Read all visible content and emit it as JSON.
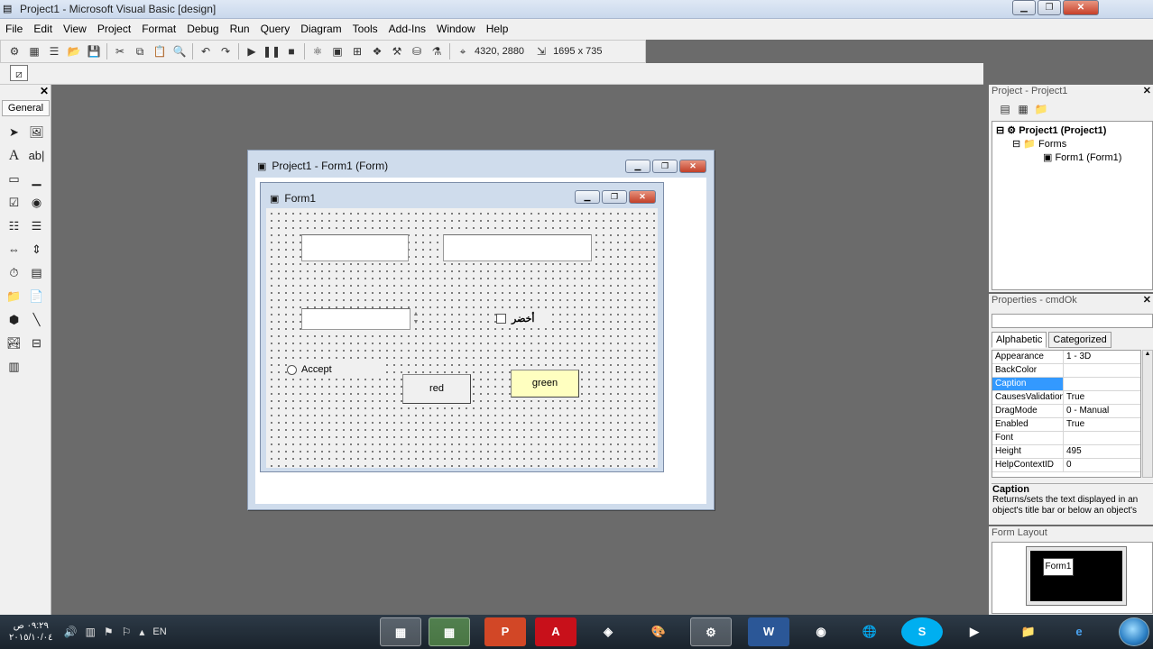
{
  "window": {
    "title": "Project1 - Microsoft Visual Basic [design]",
    "minimize": "▁",
    "restore": "❐",
    "close": "✕"
  },
  "menu": [
    "File",
    "Edit",
    "View",
    "Project",
    "Format",
    "Debug",
    "Run",
    "Query",
    "Diagram",
    "Tools",
    "Add-Ins",
    "Window",
    "Help"
  ],
  "toolbar": {
    "position": "4320, 2880",
    "size": "1695 x 735"
  },
  "toolbox": {
    "tab_label": "General",
    "close": "✕"
  },
  "form_window": {
    "title": "Project1 - Form1 (Form)"
  },
  "form1": {
    "title": "Form1",
    "checkbox_label": "أخضر",
    "radio_label": "Accept",
    "button_red": "red",
    "button_green": "green"
  },
  "project_explorer": {
    "title": "Project - Project1",
    "close": "✕",
    "root": "Project1 (Project1)",
    "folder": "Forms",
    "item": "Form1 (Form1)"
  },
  "properties": {
    "title": "Properties - cmdOk",
    "tabs": [
      "Alphabetic",
      "Categorized"
    ],
    "rows": [
      {
        "name": "Appearance",
        "value": "1 - 3D"
      },
      {
        "name": "BackColor",
        "value": ""
      },
      {
        "name": "Caption",
        "value": ""
      },
      {
        "name": "CausesValidation",
        "value": "True"
      },
      {
        "name": "DragMode",
        "value": "0 - Manual"
      },
      {
        "name": "Enabled",
        "value": "True"
      },
      {
        "name": "Font",
        "value": ""
      },
      {
        "name": "Height",
        "value": "495"
      },
      {
        "name": "HelpContextID",
        "value": "0"
      }
    ],
    "selected_row": "Caption",
    "desc_title": "Caption",
    "desc_text": "Returns/sets the text displayed in an object's title bar or below an object's"
  },
  "form_layout": {
    "title": "Form Layout",
    "mini_form": "Form1"
  },
  "taskbar": {
    "time": "٠٩:٢٩ ص",
    "date": "٢٠١٥/١٠/٠٤",
    "language": "EN"
  },
  "colors": {
    "selection": "#3399ff",
    "button_green_bg": "#ffffc0",
    "workspace": "#6b6b6b"
  }
}
